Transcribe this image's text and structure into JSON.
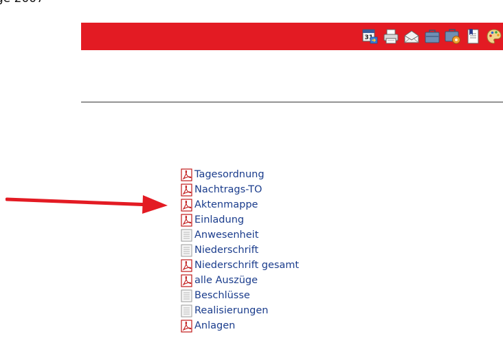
{
  "header": {
    "fragment_text": "ge 2007"
  },
  "toolbar": {
    "bg_color": "#e31b23",
    "icons": [
      {
        "name": "calendar-export-icon"
      },
      {
        "name": "printer-icon"
      },
      {
        "name": "mail-envelope-icon"
      },
      {
        "name": "briefcase-icon"
      },
      {
        "name": "briefcase-settings-icon"
      },
      {
        "name": "bookmark-document-icon"
      },
      {
        "name": "palette-icon"
      }
    ]
  },
  "documents": {
    "items": [
      {
        "label": "Tagesordnung",
        "icon": "pdf-icon"
      },
      {
        "label": "Nachtrags-TO",
        "icon": "pdf-icon"
      },
      {
        "label": "Aktenmappe",
        "icon": "pdf-icon"
      },
      {
        "label": "Einladung",
        "icon": "pdf-icon"
      },
      {
        "label": "Anwesenheit",
        "icon": "text-document-icon"
      },
      {
        "label": "Niederschrift",
        "icon": "text-document-icon"
      },
      {
        "label": "Niederschrift gesamt",
        "icon": "pdf-icon"
      },
      {
        "label": "alle Auszüge",
        "icon": "pdf-icon"
      },
      {
        "label": "Beschlüsse",
        "icon": "text-document-icon"
      },
      {
        "label": "Realisierungen",
        "icon": "text-document-icon"
      },
      {
        "label": "Anlagen",
        "icon": "pdf-icon"
      }
    ]
  },
  "annotation": {
    "arrow_color": "#e31b23"
  }
}
